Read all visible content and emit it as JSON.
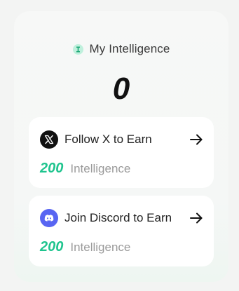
{
  "panel": {
    "title": "My Intelligence",
    "title_icon": "intelligence-icon",
    "value": "0"
  },
  "tasks": [
    {
      "icon": "x-logo-icon",
      "label": "Follow X to Earn",
      "reward_amount": "200",
      "reward_unit": "Intelligence"
    },
    {
      "icon": "discord-logo-icon",
      "label": "Join Discord to Earn",
      "reward_amount": "200",
      "reward_unit": "Intelligence"
    }
  ],
  "colors": {
    "accent": "#1fc48e",
    "discord": "#5865f2",
    "x_brand": "#111111"
  }
}
